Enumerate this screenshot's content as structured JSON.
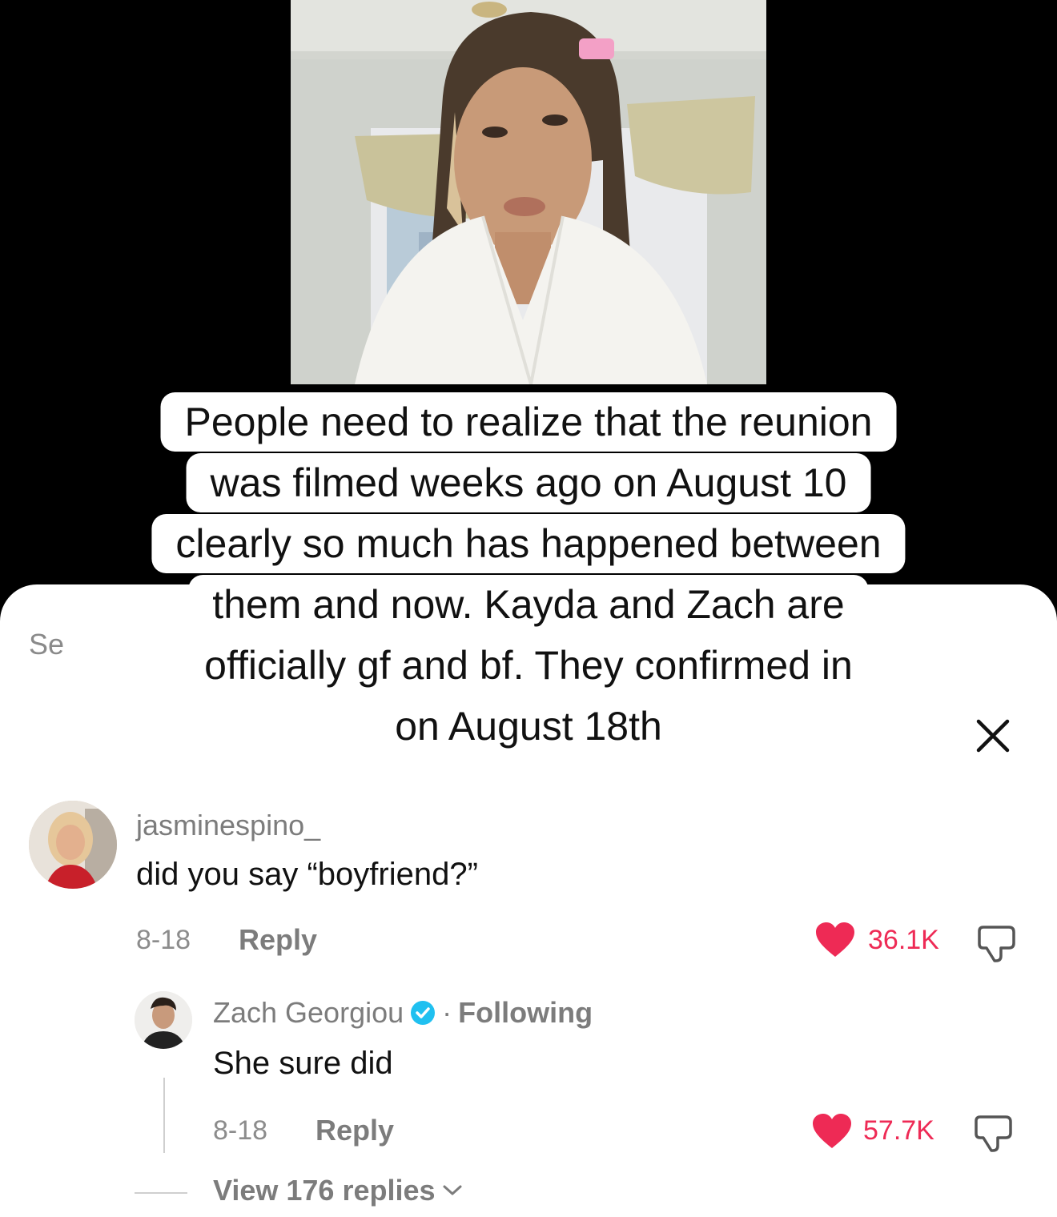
{
  "caption": {
    "lines": [
      "People need to realize that the reunion",
      "was filmed weeks ago on August 10",
      "clearly so much has happened between",
      "them and now. Kayda and Zach are",
      "officially gf and bf. They confirmed in",
      "on August 18th"
    ]
  },
  "sheet": {
    "peek_text": "Se"
  },
  "comments": [
    {
      "username": "jasminespino_",
      "text": "did you say “boyfriend?”",
      "date": "8-18",
      "reply_label": "Reply",
      "likes": "36.1K"
    }
  ],
  "reply": {
    "username": "Zach Georgiou",
    "separator": "·",
    "following_label": "Following",
    "text": "She sure did",
    "date": "8-18",
    "reply_label": "Reply",
    "likes": "57.7K"
  },
  "view_replies_label": "View 176 replies",
  "colors": {
    "like_red": "#ee2a55",
    "verified_blue": "#20c0f0",
    "muted_gray": "#7c7c7c"
  }
}
